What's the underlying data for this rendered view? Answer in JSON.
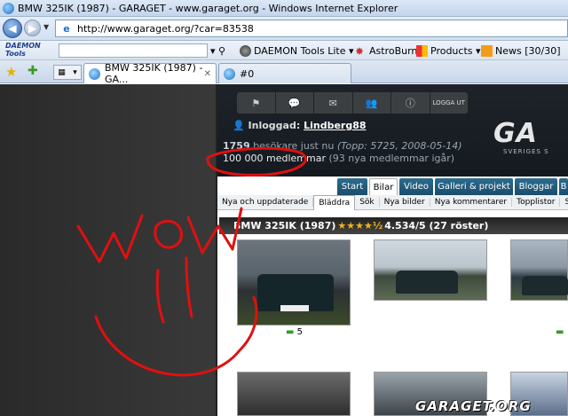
{
  "window": {
    "title": "BMW 325IK (1987) - GARAGET - www.garaget.org - Windows Internet Explorer"
  },
  "address_bar": {
    "url": "http://www.garaget.org/?car=83538"
  },
  "toolbar": {
    "daemon_logo": "DAEMON Tools",
    "items": [
      "DAEMON Tools Lite",
      "AstroBurn",
      "Products",
      "News [30/30]"
    ]
  },
  "tabs": [
    {
      "label": "BMW 325IK (1987) - GA..."
    },
    {
      "label": "#0"
    }
  ],
  "site": {
    "nav_icons": [
      "flag",
      "chat",
      "mail",
      "people",
      "info"
    ],
    "logout_label": "LOGGA UT",
    "login_prefix": "Inloggad:",
    "login_user": "Lindberg88",
    "stats_online_count": "1759",
    "stats_online_text": "besökare just nu",
    "stats_top": "(Topp: 5725, 2008-05-14)",
    "members": "100 000 medlemmar",
    "members_new": "(93 nya medlemmar igår)",
    "logo": "GA",
    "logo_sub": "SVERIGES S",
    "main_tabs": [
      "Start",
      "Bilar",
      "Video",
      "Galleri & projekt",
      "Bloggar",
      "B"
    ],
    "sub_tabs": [
      "Nya och uppdaterade",
      "Bläddra",
      "Sök",
      "Nya bilder",
      "Nya kommentarer",
      "Topplistor",
      "Slump"
    ],
    "car_title": "BMW 325IK (1987)",
    "car_stars": "★★★★½",
    "car_rating": "4.534/5 (27 röster)",
    "photo_count": "5",
    "watermark": "GARAGET.ORG"
  },
  "annotation": {
    "text": "WOW",
    "color": "#e01010"
  },
  "colors": {
    "site_header_bg": "#1a2026",
    "tab_blue": "#1f5878",
    "rating_star": "#f2b21c"
  }
}
